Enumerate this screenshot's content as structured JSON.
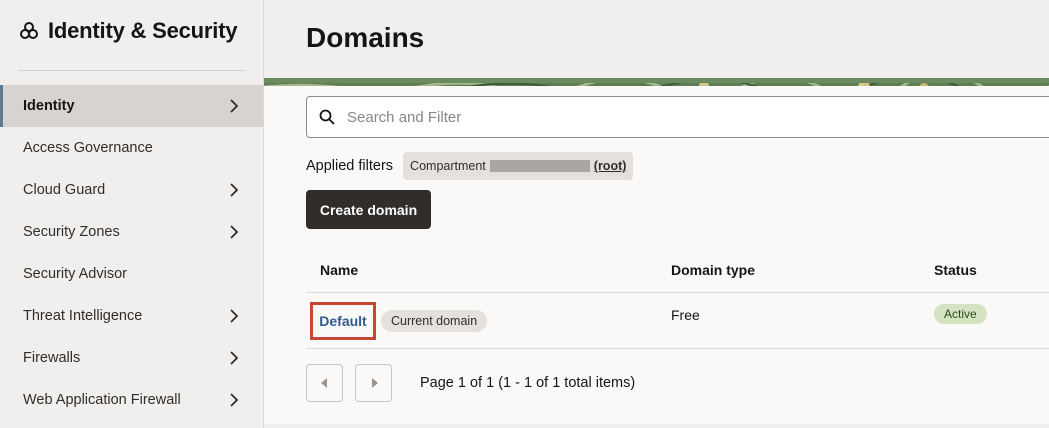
{
  "sidebar": {
    "title": "Identity & Security",
    "items": [
      {
        "label": "Identity",
        "has_arrow": true,
        "active": true
      },
      {
        "label": "Access Governance",
        "has_arrow": false
      },
      {
        "label": "Cloud Guard",
        "has_arrow": true
      },
      {
        "label": "Security Zones",
        "has_arrow": true
      },
      {
        "label": "Security Advisor",
        "has_arrow": false
      },
      {
        "label": "Threat Intelligence",
        "has_arrow": true
      },
      {
        "label": "Firewalls",
        "has_arrow": true
      },
      {
        "label": "Web Application Firewall",
        "has_arrow": true
      }
    ]
  },
  "main": {
    "title": "Domains",
    "search": {
      "placeholder": "Search and Filter"
    },
    "filters": {
      "label": "Applied filters",
      "chip_prefix": "Compartment",
      "chip_value": "(root)"
    },
    "create_button": "Create domain",
    "table": {
      "headers": [
        "Name",
        "Domain type",
        "Status"
      ],
      "rows": [
        {
          "name": "Default",
          "badge": "Current domain",
          "type": "Free",
          "status": "Active"
        }
      ]
    },
    "pagination": {
      "info": "Page 1 of 1 (1 - 1 of 1 total items)"
    }
  },
  "colors": {
    "accent_border": "#c74634",
    "link": "#2f5b8f",
    "active_status_bg": "#d4e4c2",
    "button_bg": "#312d2a"
  }
}
